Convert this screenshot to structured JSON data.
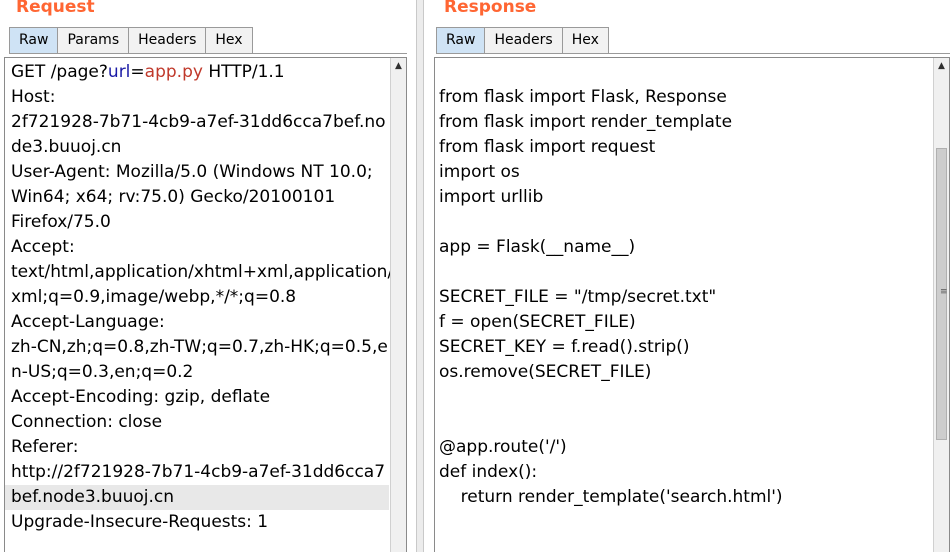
{
  "request": {
    "title": "Request",
    "tabs": [
      {
        "label": "Raw",
        "active": true
      },
      {
        "label": "Params",
        "active": false
      },
      {
        "label": "Headers",
        "active": false
      },
      {
        "label": "Hex",
        "active": false
      }
    ],
    "first_line": {
      "prefix": "GET /page?",
      "param_name": "url",
      "equals": "=",
      "param_value": "app.py",
      "suffix": " HTTP/1.1"
    },
    "lines": [
      "Host:",
      "2f721928-7b71-4cb9-a7ef-31dd6cca7bef.no",
      "de3.buuoj.cn",
      "User-Agent: Mozilla/5.0 (Windows NT 10.0;",
      "Win64; x64; rv:75.0) Gecko/20100101",
      "Firefox/75.0",
      "Accept:",
      "text/html,application/xhtml+xml,application/",
      "xml;q=0.9,image/webp,*/*;q=0.8",
      "Accept-Language:",
      "zh-CN,zh;q=0.8,zh-TW;q=0.7,zh-HK;q=0.5,e",
      "n-US;q=0.3,en;q=0.2",
      "Accept-Encoding: gzip, deflate",
      "Connection: close",
      "Referer:",
      "http://2f721928-7b71-4cb9-a7ef-31dd6cca7",
      "bef.node3.buuoj.cn",
      "Upgrade-Insecure-Requests: 1"
    ],
    "highlighted_line_index": 16
  },
  "response": {
    "title": "Response",
    "tabs": [
      {
        "label": "Raw",
        "active": true
      },
      {
        "label": "Headers",
        "active": false
      },
      {
        "label": "Hex",
        "active": false
      }
    ],
    "lines": [
      "from flask import Flask, Response",
      "from flask import render_template",
      "from flask import request",
      "import os",
      "import urllib",
      "",
      "app = Flask(__name__)",
      "",
      "SECRET_FILE = \"/tmp/secret.txt\"",
      "f = open(SECRET_FILE)",
      "SECRET_KEY = f.read().strip()",
      "os.remove(SECRET_FILE)",
      "",
      "",
      "@app.route('/')",
      "def index():",
      "    return render_template('search.html')"
    ]
  },
  "icons": {
    "scroll_up": "triangle-up-icon",
    "thumb_grip": "grip-lines-icon"
  },
  "colors": {
    "title": "#ff6633",
    "active_tab": "#cfe3f5",
    "param_name": "#1a1aa6",
    "param_value": "#c0392b"
  }
}
